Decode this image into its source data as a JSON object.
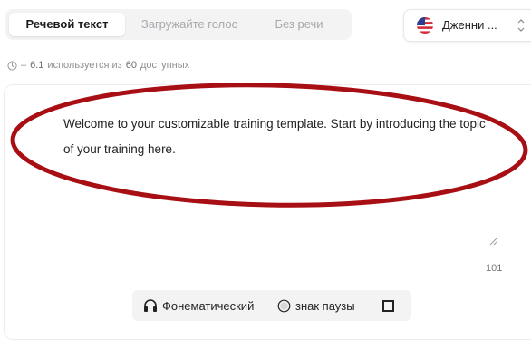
{
  "tabs": [
    {
      "label": "Речевой текст",
      "active": true
    },
    {
      "label": "Загружайте голос",
      "active": false
    },
    {
      "label": "Без речи",
      "active": false
    }
  ],
  "voice": {
    "name": "Дженни ...",
    "flag_icon": "us-flag-icon"
  },
  "usage": {
    "dash": "–",
    "used": "6.1",
    "used_text": "используется из",
    "available": "60",
    "available_text": "доступных"
  },
  "editor": {
    "text": "Welcome to your customizable training template. Start by introducing the topic of your training here.",
    "char_count": "101"
  },
  "toolbar": {
    "phonetic_label": "Фонематический",
    "pause_label": "знак паузы"
  },
  "colors": {
    "annotation_oval": "#a80f14",
    "accent": "#1c1c1e"
  }
}
